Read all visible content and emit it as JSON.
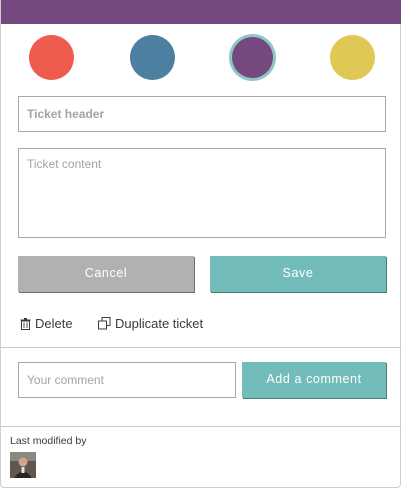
{
  "colors": {
    "topbar": "#75497f",
    "swatches": [
      "#ee5c4f",
      "#4d80a0",
      "#75497f",
      "#dfc855"
    ],
    "selected_ring": "#8ec8c6",
    "primary_button": "#72bdb9",
    "secondary_button": "#b1b1b1"
  },
  "swatches": [
    {
      "color": "#ee5c4f",
      "selected": false
    },
    {
      "color": "#4d80a0",
      "selected": false
    },
    {
      "color": "#75497f",
      "selected": true
    },
    {
      "color": "#dfc855",
      "selected": false
    }
  ],
  "form": {
    "header_placeholder": "Ticket header",
    "content_placeholder": "Ticket content"
  },
  "buttons": {
    "cancel": "Cancel",
    "save": "Save",
    "add_comment": "Add a comment"
  },
  "actions": {
    "delete": "Delete",
    "duplicate": "Duplicate ticket",
    "delete_icon": "trash-icon",
    "duplicate_icon": "copy-icon"
  },
  "comment": {
    "placeholder": "Your comment"
  },
  "footer": {
    "last_modified_label": "Last modified by"
  }
}
